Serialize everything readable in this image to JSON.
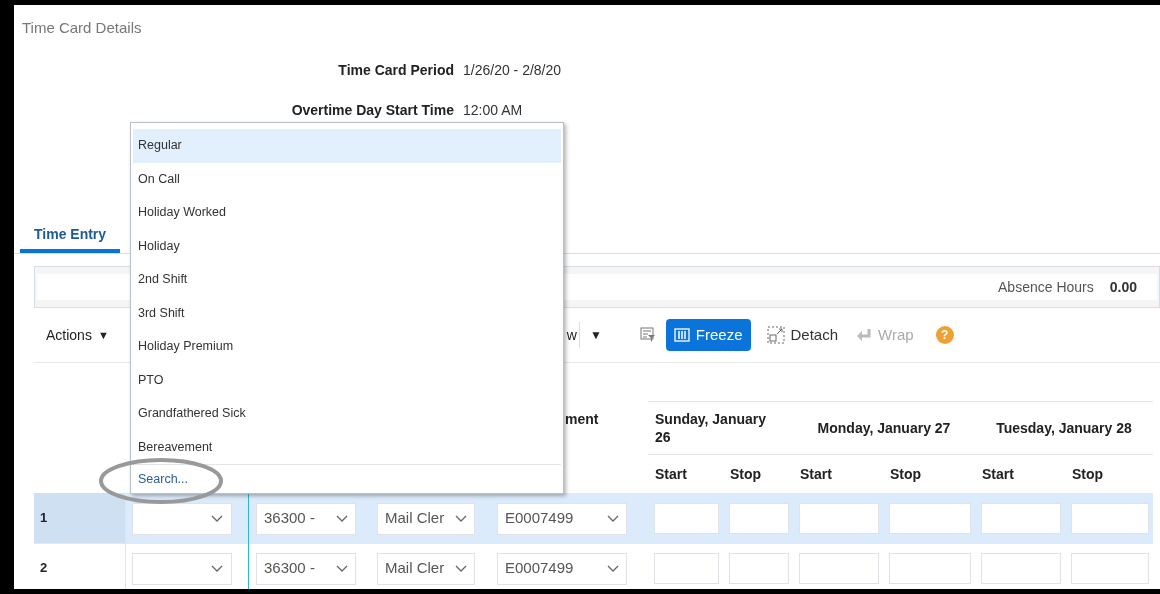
{
  "page_title": "Time Card Details",
  "fields": [
    {
      "label": "Time Card Period",
      "value": "1/26/20 - 2/8/20"
    },
    {
      "label": "Overtime Day Start Time",
      "value": "12:00 AM"
    }
  ],
  "tabs": [
    {
      "label": "Time Entry",
      "selected": true
    }
  ],
  "summary": {
    "label": "Absence Hours",
    "value": "0.00"
  },
  "toolbar": {
    "actions": "Actions",
    "actions_caret": "▼",
    "view_fragment": "w",
    "view_caret": "▼",
    "buttons": [
      {
        "label": "Freeze",
        "kind": "primary",
        "disabled": false
      },
      {
        "label": "Detach",
        "kind": "plain",
        "disabled": false
      },
      {
        "label": "Wrap",
        "kind": "plain",
        "disabled": true
      }
    ],
    "help": "?"
  },
  "table": {
    "partial_header": "ment",
    "days": [
      {
        "label": "Sunday, January 26",
        "columns": [
          "Start",
          "Stop"
        ]
      },
      {
        "label": "Monday, January 27",
        "columns": [
          "Start",
          "Stop"
        ]
      },
      {
        "label": "Tuesday, January 28",
        "columns": [
          "Start",
          "Stop"
        ]
      }
    ],
    "rows": [
      {
        "number": "1",
        "selected": true,
        "cells": [
          "36300 -",
          "Mail Cler",
          "E0007499"
        ]
      },
      {
        "number": "2",
        "selected": false,
        "cells": [
          "36300 -",
          "Mail Cler",
          "E0007499"
        ]
      }
    ]
  },
  "dropdown": {
    "items": [
      {
        "label": "Regular",
        "selected": true
      },
      {
        "label": "On Call",
        "selected": false
      },
      {
        "label": "Holiday Worked",
        "selected": false
      },
      {
        "label": "Holiday",
        "selected": false
      },
      {
        "label": "2nd Shift",
        "selected": false
      },
      {
        "label": "3rd Shift",
        "selected": false
      },
      {
        "label": "Holiday Premium",
        "selected": false
      },
      {
        "label": "PTO",
        "selected": false
      },
      {
        "label": "Grandfathered Sick",
        "selected": false
      },
      {
        "label": "Bereavement",
        "selected": false
      }
    ],
    "search": "Search...",
    "circled": true
  }
}
